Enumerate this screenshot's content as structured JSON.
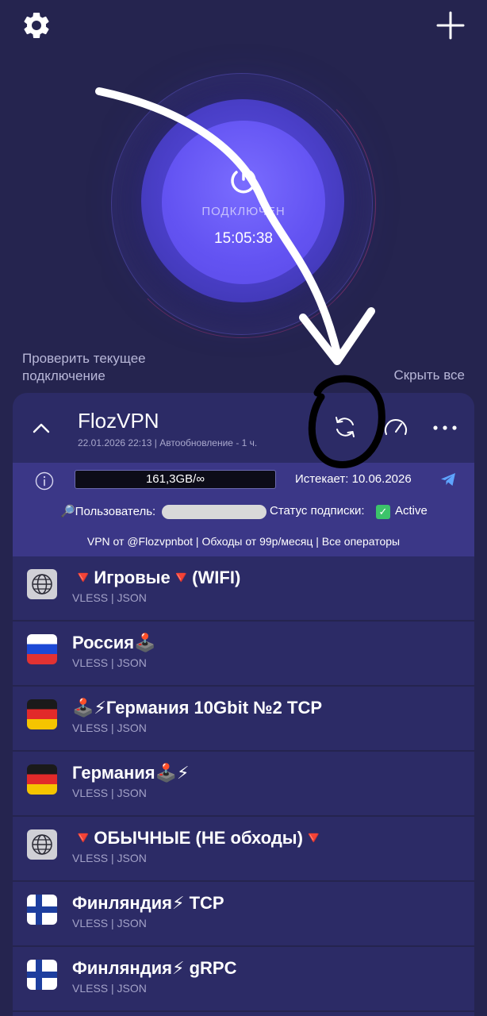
{
  "header": {
    "settings_icon": "gear-icon",
    "add_icon": "plus-icon"
  },
  "connection": {
    "status": "ПОДКЛЮЧЕН",
    "timer": "15:05:38"
  },
  "check_connection": "Проверить текущее подключение",
  "hide_all": "Скрыть все",
  "subscription": {
    "name": "FlozVPN",
    "meta": "22.01.2026 22:13 | Автообновление - 1 ч.",
    "traffic": "161,3GB/∞",
    "expires": "Истекает: 10.06.2026",
    "user_label": "🔎Пользователь:",
    "status_label": "Статус подписки:",
    "status_check": "✓",
    "status_value": "Active",
    "promo": "VPN от @Flozvpnbot | Обходы от 99р/месяц | Все операторы"
  },
  "servers": [
    {
      "name": "🔻Игровые🔻(WIFI)",
      "proto": "VLESS | JSON",
      "flag": "globe"
    },
    {
      "name": "Россия🕹️",
      "proto": "VLESS | JSON",
      "flag": "ru"
    },
    {
      "name": "🕹️⚡Германия 10Gbit №2 TCP",
      "proto": "VLESS | JSON",
      "flag": "de"
    },
    {
      "name": "Германия🕹️⚡",
      "proto": "VLESS | JSON",
      "flag": "de"
    },
    {
      "name": "🔻ОБЫЧНЫЕ (НЕ обходы)🔻",
      "proto": "VLESS | JSON",
      "flag": "globe"
    },
    {
      "name": "Финляндия⚡ TCP",
      "proto": "VLESS | JSON",
      "flag": "fi"
    },
    {
      "name": "Финляндия⚡ gRPC",
      "proto": "VLESS | JSON",
      "flag": "fi"
    }
  ],
  "colors": {
    "background": "#25244f",
    "card": "#2c2b66",
    "info_panel": "#3b3787",
    "accent": "#6353f2"
  }
}
